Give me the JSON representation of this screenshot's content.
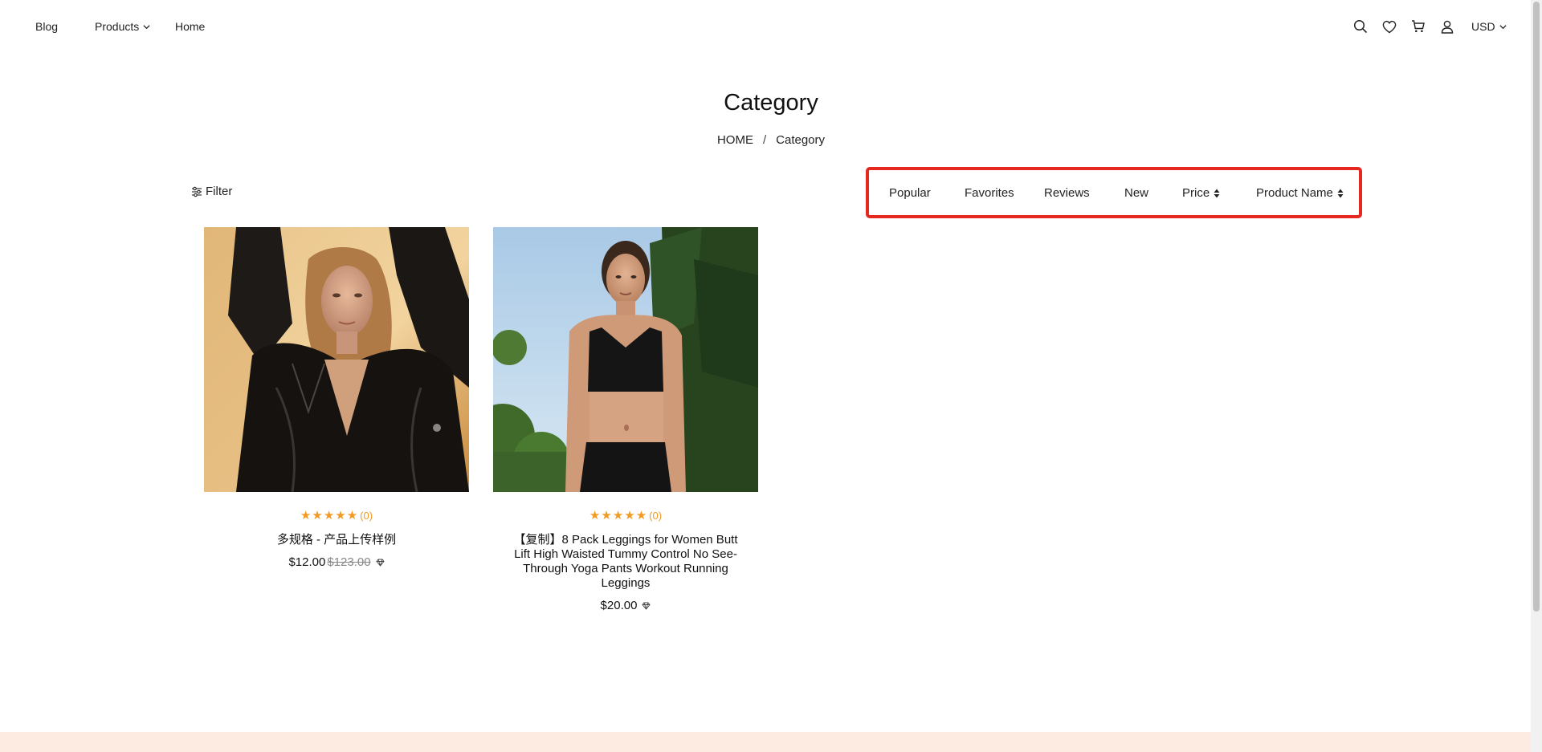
{
  "header": {
    "nav": [
      {
        "label": "Blog"
      },
      {
        "label": "Products"
      },
      {
        "label": "Home"
      }
    ],
    "icons": [
      "search-icon",
      "heart-icon",
      "cart-icon",
      "user-icon"
    ],
    "currency": "USD"
  },
  "page": {
    "title": "Category",
    "breadcrumb": {
      "home": "HOME",
      "separator": "/",
      "current": "Category"
    }
  },
  "toolbar": {
    "filter_label": "Filter",
    "sort_options": [
      "Popular",
      "Favorites",
      "Reviews",
      "New",
      "Price",
      "Product Name"
    ]
  },
  "products": [
    {
      "name": "多规格 - 产品上传样例",
      "rating_count": "(0)",
      "price": "$12.00",
      "old_price": "$123.00"
    },
    {
      "name": "【复制】8 Pack Leggings for Women Butt Lift High Waisted Tummy Control No See-Through Yoga Pants Workout Running Leggings",
      "rating_count": "(0)",
      "price": "$20.00"
    }
  ],
  "colors": {
    "star": "#f29a22",
    "highlight": "#e52820",
    "footer": "#fdebe1"
  }
}
